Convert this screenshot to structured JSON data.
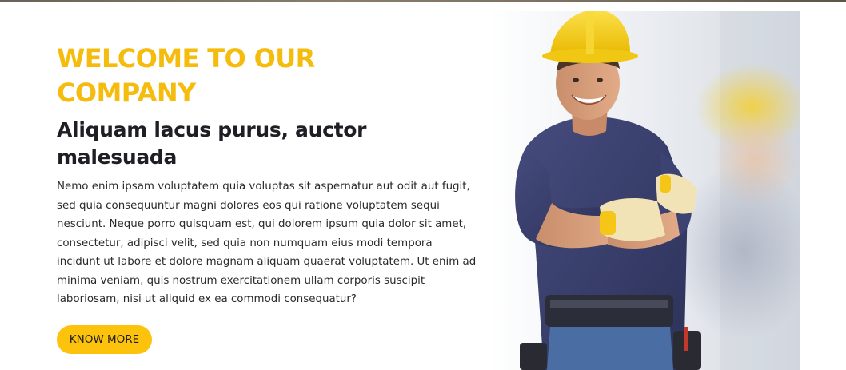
{
  "hero": {
    "heading": "WELCOME TO OUR COMPANY",
    "subheading": "Aliquam lacus purus, auctor malesuada",
    "paragraph": "Nemo enim ipsam voluptatem quia voluptas sit aspernatur aut odit aut fugit, sed quia consequuntur magni dolores eos qui ratione voluptatem sequi nesciunt. Neque porro quisquam est, qui dolorem ipsum quia dolor sit amet, consectetur, adipisci velit, sed quia non numquam eius modi tempora incidunt ut labore et dolore magnam aliquam quaerat voluptatem. Ut enim ad minima veniam, quis nostrum exercitationem ullam corporis suscipit laboriosam, nisi ut aliquid ex ea commodi consequatur?",
    "cta_label": "KNOW MORE",
    "image_subject": "construction-worker-photo"
  },
  "colors": {
    "accent": "#f5bc0d",
    "button_bg": "#fdc20b",
    "heading_dark": "#1e1e24",
    "shirt": "#3a3f6b",
    "helmet": "#f7d31a"
  }
}
